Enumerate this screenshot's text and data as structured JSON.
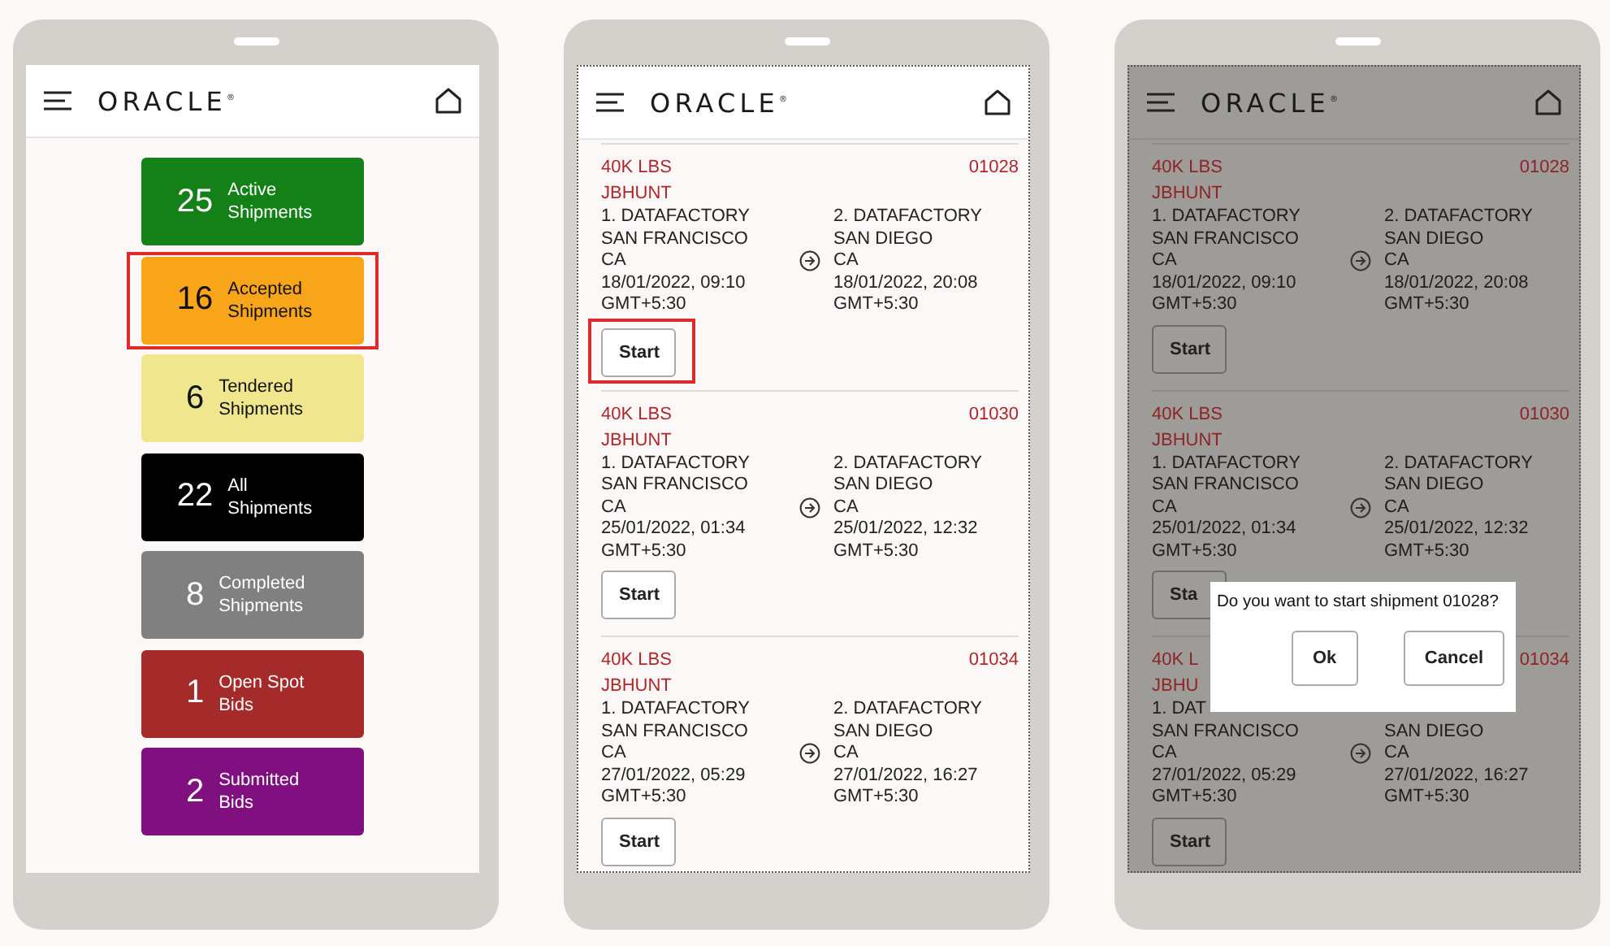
{
  "screens": [
    {
      "kind": "dashboard",
      "dimmed": false,
      "header": {
        "logo": "ORACLE$^{®}$"
      },
      "tiles": [
        {
          "count": "25",
          "label": "Active Shipments",
          "color": "#138018",
          "highlighted": false
        },
        {
          "count": "16",
          "label": "Accepted Shipments",
          "color": "#f9a51a",
          "highlighted": true
        },
        {
          "count": "6",
          "label": "Tendered Shipments",
          "color": "#efe68d",
          "highlighted": false
        },
        {
          "count": "22",
          "label": "All Shipments",
          "color": "#000000",
          "highlighted": false
        },
        {
          "count": "8",
          "label": "Completed Shipments",
          "color": "#808080",
          "highlighted": false
        },
        {
          "count": "1",
          "label": "Open Spot Bids",
          "color": "#a52a2a",
          "highlighted": false
        },
        {
          "count": "2",
          "label": "Submitted Bids",
          "color": "#800f80",
          "highlighted": false
        }
      ]
    },
    {
      "kind": "list",
      "dimmed": false,
      "header": {
        "logo": "ORACLE$^{®}$"
      },
      "cards": [
        {
          "weight": "40K LBS",
          "id": "01028",
          "carrier": "JBHUNT",
          "origin": [
            "1. DATAFACTORY",
            "SAN FRANCISCO",
            "CA",
            "18/01/2022, 09:10",
            "GMT+5:30"
          ],
          "destination": [
            "2. DATAFACTORY",
            "SAN DIEGO",
            "CA",
            "18/01/2022, 20:08",
            "GMT+5:30"
          ],
          "button": "Start",
          "highlighted": true
        },
        {
          "weight": "40K LBS",
          "id": "01030",
          "carrier": "JBHUNT",
          "origin": [
            "1. DATAFACTORY",
            "SAN FRANCISCO",
            "CA",
            "25/01/2022, 01:34",
            "GMT+5:30"
          ],
          "destination": [
            "2. DATAFACTORY",
            "SAN DIEGO",
            "CA",
            "25/01/2022, 12:32",
            "GMT+5:30"
          ],
          "button": "Start",
          "highlighted": false
        },
        {
          "weight": "40K LBS",
          "id": "01034",
          "carrier": "JBHUNT",
          "origin": [
            "1. DATAFACTORY",
            "SAN FRANCISCO",
            "CA",
            "27/01/2022, 05:29",
            "GMT+5:30"
          ],
          "destination": [
            "2. DATAFACTORY",
            "SAN DIEGO",
            "CA",
            "27/01/2022, 16:27",
            "GMT+5:30"
          ],
          "button": "Start",
          "highlighted": false
        }
      ]
    },
    {
      "kind": "list",
      "dimmed": true,
      "header": {
        "logo": "ORACLE$^{®}$"
      },
      "cards": [
        {
          "weight": "40K LBS",
          "id": "01028",
          "carrier": "JBHUNT",
          "origin": [
            "1. DATAFACTORY",
            "SAN FRANCISCO",
            "CA",
            "18/01/2022, 09:10",
            "GMT+5:30"
          ],
          "destination": [
            "2. DATAFACTORY",
            "SAN DIEGO",
            "CA",
            "18/01/2022, 20:08",
            "GMT+5:30"
          ],
          "button": "Start",
          "highlighted": false
        },
        {
          "weight": "40K LBS",
          "id": "01030",
          "carrier": "JBHUNT",
          "origin": [
            "1. DATAFACTORY",
            "SAN FRANCISCO",
            "CA",
            "25/01/2022, 01:34",
            "GMT+5:30"
          ],
          "destination": [
            "2. DATAFACTORY",
            "SAN DIEGO",
            "CA",
            "25/01/2022, 12:32",
            "GMT+5:30"
          ],
          "button": "Sta",
          "highlighted": false
        },
        {
          "weight": "40K L",
          "id": "01034",
          "carrier": "JBHU",
          "origin": [
            "1. DAT",
            "SAN FRANCISCO",
            "CA",
            "27/01/2022, 05:29",
            "GMT+5:30"
          ],
          "destination": [
            "SAN DIEGO",
            "CA",
            "27/01/2022, 16:27",
            "GMT+5:30"
          ],
          "button": "Start",
          "highlighted": false
        }
      ],
      "dialog": {
        "message": "Do you want to start shipment 01028?",
        "buttons": [
          "Ok",
          "Cancel"
        ]
      }
    }
  ]
}
